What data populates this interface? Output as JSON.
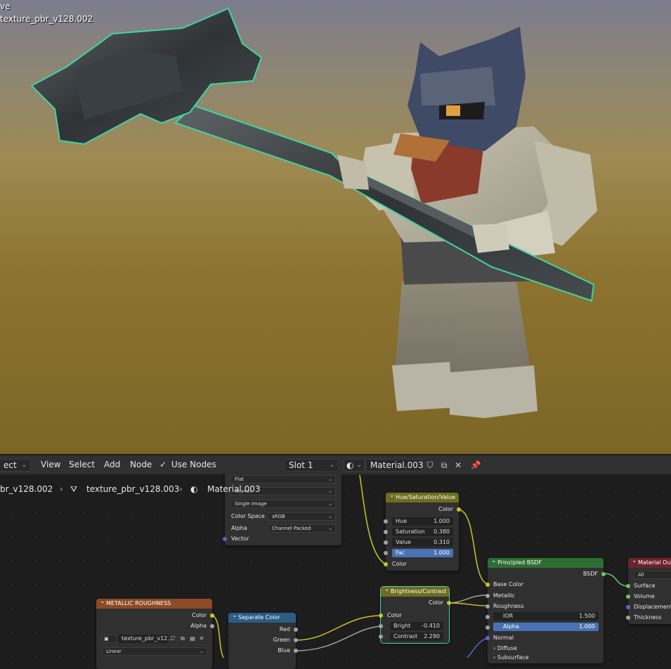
{
  "viewport": {
    "overlay_line1": "ve",
    "overlay_line2": "texture_pbr_v128.002"
  },
  "header": {
    "mode_select": "ect",
    "menu": [
      "View",
      "Select",
      "Add",
      "Node"
    ],
    "use_nodes_label": "Use Nodes",
    "use_nodes_checked": true,
    "slot": "Slot 1",
    "material_name": "Material.003"
  },
  "breadcrumb": {
    "object": "br_v128.002",
    "mesh": "texture_pbr_v128.003",
    "material": "Material.003"
  },
  "nodes": {
    "image_texture": {
      "projection": "Flat",
      "extension": "Repeat",
      "source": "Single Image",
      "color_space_label": "Color Space",
      "color_space": "sRGB",
      "alpha_label": "Alpha",
      "alpha": "Channel Packed",
      "vector": "Vector"
    },
    "hsv": {
      "title": "Hue/Saturation/Value",
      "out_color": "Color",
      "hue_label": "Hue",
      "hue": "1.000",
      "sat_label": "Saturation",
      "sat": "0.380",
      "val_label": "Value",
      "val": "0.310",
      "fac_label": "Fac",
      "fac": "1.000",
      "in_color": "Color"
    },
    "brightness": {
      "title": "Brightness/Contrast",
      "out_color": "Color",
      "in_color": "Color",
      "bright_label": "Bright",
      "bright": "-0.410",
      "contrast_label": "Contrast",
      "contrast": "2.290"
    },
    "principled": {
      "title": "Principled BSDF",
      "out": "BSDF",
      "base_color": "Base Color",
      "metallic": "Metallic",
      "roughness": "Roughness",
      "ior_label": "IOR",
      "ior": "1.500",
      "alpha_label": "Alpha",
      "alpha": "1.000",
      "normal": "Normal",
      "diffuse": "Diffuse",
      "subsurface": "Subsurface"
    },
    "output": {
      "title": "Material Out",
      "target": "All",
      "surface": "Surface",
      "volume": "Volume",
      "displacement": "Displacement",
      "thickness": "Thickness"
    },
    "metal_rough": {
      "title": "METALLIC ROUGHNESS",
      "out_color": "Color",
      "out_alpha": "Alpha",
      "image_name": "texture_pbr_v12...",
      "interp": "Linear"
    },
    "separate": {
      "title": "Separate Color",
      "red": "Red",
      "green": "Green",
      "blue": "Blue"
    }
  },
  "colors": {
    "selection_outline": "#3fd5a3",
    "hsv_header": "#6e6d1f",
    "principled_header": "#2f6e33",
    "output_header": "#6e2130",
    "texture_header": "#8c4b26",
    "separate_header": "#2a5d85",
    "socket_color": "#c7c729",
    "socket_float": "#a1a1a1",
    "socket_shader": "#63c763",
    "socket_vector": "#6363c7"
  }
}
